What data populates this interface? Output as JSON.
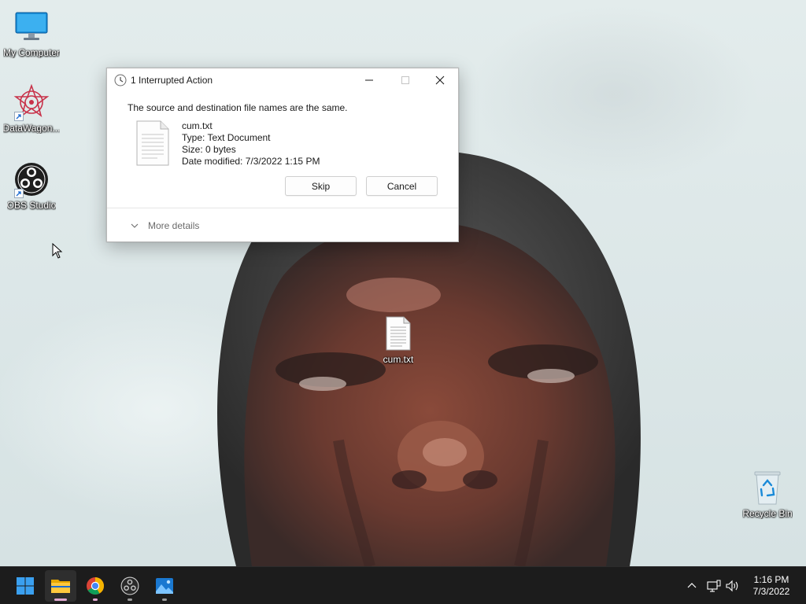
{
  "desktop": {
    "icons": [
      {
        "label": "My Computer",
        "icon": "monitor-icon"
      },
      {
        "label": "DataWagon...",
        "icon": "datawagon-icon"
      },
      {
        "label": "OBS Studio",
        "icon": "obs-icon"
      },
      {
        "label": "cum.txt",
        "icon": "text-file-icon"
      },
      {
        "label": "Recycle Bin",
        "icon": "recycle-bin-icon"
      }
    ]
  },
  "dialog": {
    "title": "1 Interrupted Action",
    "message": "The source and destination file names are the same.",
    "file": {
      "name": "cum.txt",
      "type": "Type: Text Document",
      "size": "Size: 0 bytes",
      "modified": "Date modified: 7/3/2022 1:15 PM"
    },
    "buttons": {
      "skip": "Skip",
      "cancel": "Cancel"
    },
    "more_details": "More details"
  },
  "taskbar": {
    "apps": [
      {
        "name": "start",
        "icon": "windows-logo-icon"
      },
      {
        "name": "file-explorer",
        "icon": "folder-icon",
        "active": true
      },
      {
        "name": "chrome",
        "icon": "chrome-icon"
      },
      {
        "name": "obs-studio",
        "icon": "obs-icon"
      },
      {
        "name": "photos",
        "icon": "photos-icon"
      }
    ],
    "clock": {
      "time": "1:16 PM",
      "date": "7/3/2022"
    }
  },
  "colors": {
    "taskbar": "#1c1c1c",
    "dialog_bg": "#ffffff",
    "accent": "#0067c0",
    "wallpaper": "#dfe9ea"
  }
}
